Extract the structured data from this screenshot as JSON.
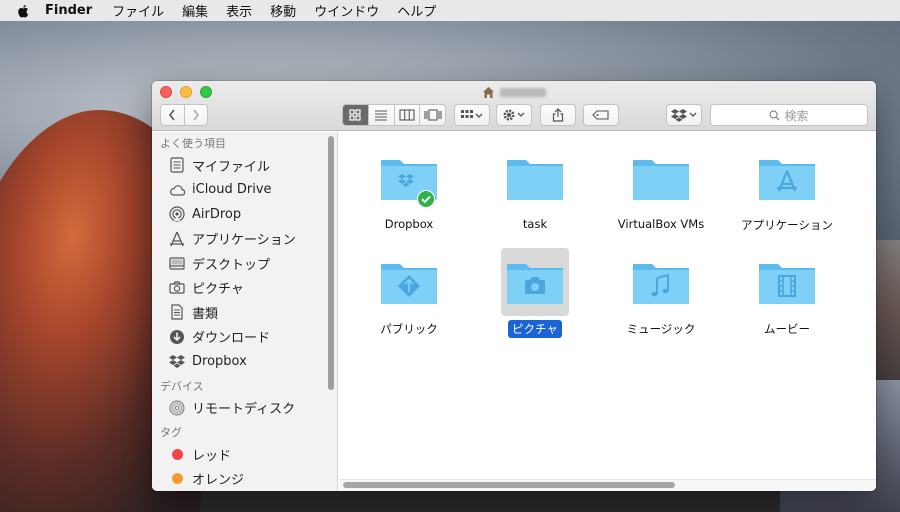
{
  "menubar": {
    "app_name": "Finder",
    "items": [
      "ファイル",
      "編集",
      "表示",
      "移動",
      "ウインドウ",
      "ヘルプ"
    ]
  },
  "window": {
    "toolbar": {
      "search_placeholder": "検索",
      "view_modes": [
        "icon",
        "list",
        "columns",
        "coverflow"
      ],
      "active_view": "icon"
    }
  },
  "sidebar": {
    "sections": [
      {
        "header": "よく使う項目",
        "items": [
          {
            "label": "マイファイル",
            "icon": "all-files-icon"
          },
          {
            "label": "iCloud Drive",
            "icon": "cloud-icon"
          },
          {
            "label": "AirDrop",
            "icon": "airdrop-icon"
          },
          {
            "label": "アプリケーション",
            "icon": "applications-icon"
          },
          {
            "label": "デスクトップ",
            "icon": "desktop-icon"
          },
          {
            "label": "ピクチャ",
            "icon": "camera-icon"
          },
          {
            "label": "書類",
            "icon": "documents-icon"
          },
          {
            "label": "ダウンロード",
            "icon": "download-icon"
          },
          {
            "label": "Dropbox",
            "icon": "dropbox-icon"
          }
        ]
      },
      {
        "header": "デバイス",
        "items": [
          {
            "label": "リモートディスク",
            "icon": "disc-icon"
          }
        ]
      },
      {
        "header": "タグ",
        "items": [
          {
            "label": "レッド",
            "color": "#f5454b"
          },
          {
            "label": "オレンジ",
            "color": "#f99a2e"
          }
        ]
      }
    ]
  },
  "content": {
    "items": [
      {
        "label": "Dropbox",
        "icon": "dropbox-folder-icon",
        "badge": "synced-check-icon"
      },
      {
        "label": "task",
        "icon": "folder-icon"
      },
      {
        "label": "VirtualBox VMs",
        "icon": "folder-icon"
      },
      {
        "label": "アプリケーション",
        "icon": "applications-folder-icon"
      },
      {
        "label": "パブリック",
        "icon": "public-folder-icon"
      },
      {
        "label": "ピクチャ",
        "icon": "pictures-folder-icon",
        "selected": true
      },
      {
        "label": "ミュージック",
        "icon": "music-folder-icon"
      },
      {
        "label": "ムービー",
        "icon": "movies-folder-icon"
      }
    ]
  },
  "colors": {
    "folder": "#7fd0f7",
    "folder_dark": "#5bbbee",
    "selection": "#1a64d8",
    "badge_green": "#2fb24a"
  }
}
